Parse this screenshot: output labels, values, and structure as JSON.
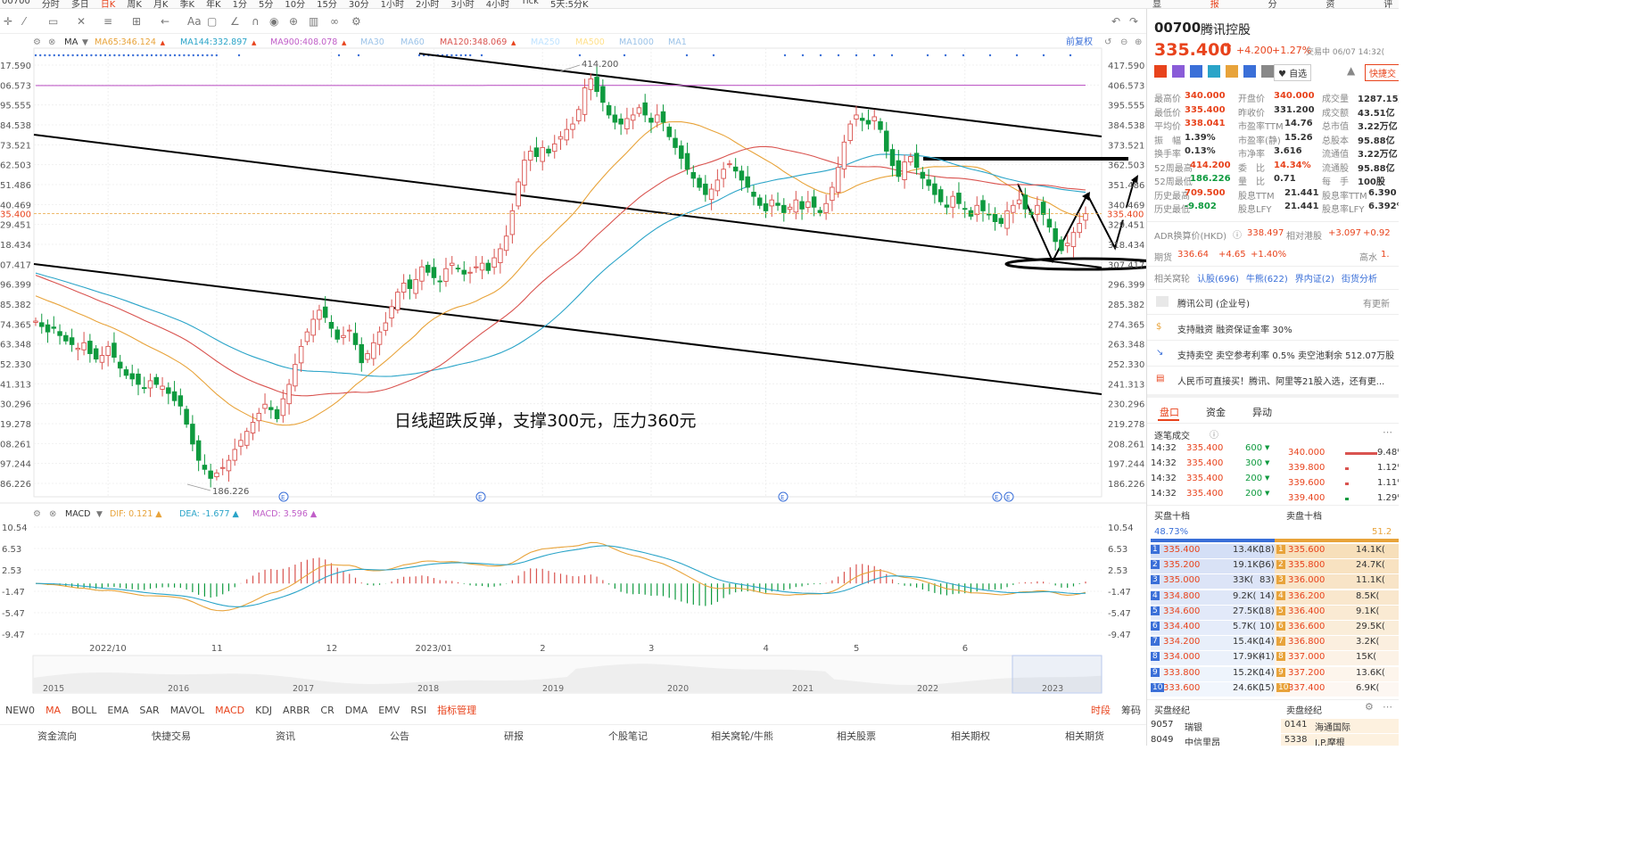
{
  "topbar": {
    "periods": [
      "00700",
      "分时",
      "多日",
      "日K",
      "周K",
      "月K",
      "季K",
      "年K",
      "1分",
      "5分",
      "10分",
      "15分",
      "30分",
      "1小时",
      "2小时",
      "3小时",
      "4小时",
      "Tick",
      "5天:5分K"
    ],
    "right": [
      "显示",
      "报价",
      "分析",
      "资讯",
      "评估"
    ]
  },
  "toolbar": {
    "restore": "前复权",
    "ma_label": "MA",
    "ma": [
      {
        "name": "MA65",
        "value": "346.124",
        "color": "#e8a33a"
      },
      {
        "name": "MA144",
        "value": "332.897",
        "color": "#2aa4c8"
      },
      {
        "name": "MA900",
        "value": "408.078",
        "color": "#c05ec8"
      },
      {
        "name": "MA30",
        "value": "",
        "color": "#9cc3e8"
      },
      {
        "name": "MA60",
        "value": "",
        "color": "#9cc3e8"
      },
      {
        "name": "MA120",
        "value": "348.069",
        "color": "#d9534f"
      },
      {
        "name": "MA250",
        "value": "",
        "color": "#bfe3ff"
      },
      {
        "name": "MA500",
        "value": "",
        "color": "#ffe08a"
      },
      {
        "name": "MA1000",
        "value": "",
        "color": "#9cc3e8"
      },
      {
        "name": "MA1",
        "value": "",
        "color": "#9cc3e8"
      }
    ]
  },
  "chart_data": [
    {
      "type": "candlestick",
      "title": "",
      "ylim": [
        180,
        420
      ],
      "y_ticks": [
        417.59,
        406.573,
        395.555,
        384.538,
        373.521,
        362.503,
        351.486,
        340.469,
        329.451,
        318.434,
        307.417,
        296.399,
        285.382,
        274.365,
        263.348,
        252.33,
        241.313,
        230.296,
        219.278,
        208.261,
        197.244,
        186.226
      ],
      "y_tick_labels": [
        "417.590",
        "406.573",
        "395.555",
        "384.538",
        "373.521",
        "362.503",
        "351.486",
        "340.469",
        "329.451",
        "318.434",
        "307.417",
        "296.399",
        "285.382",
        "274.365",
        "263.348",
        "252.330",
        "241.313",
        "230.296",
        "219.278",
        "208.261",
        "197.244",
        "186.226"
      ],
      "left_tick_labels": [
        "17.590",
        "06.573",
        "95.555",
        "84.538",
        "73.521",
        "62.503",
        "51.486",
        "40.469",
        "29.451",
        "18.434",
        "07.417",
        "96.399",
        "85.382",
        "74.365",
        "63.348",
        "52.330",
        "41.313",
        "30.296",
        "19.278",
        "08.261",
        "97.244",
        "86.226"
      ],
      "x_labels": [
        "2022/10",
        "11",
        "12",
        "2023/01",
        "2",
        "3",
        "4",
        "5",
        "6"
      ],
      "x_label_index": [
        12,
        30,
        49,
        66,
        84,
        102,
        121,
        136,
        154
      ],
      "current_price": 335.4,
      "current_price_label": "335.400",
      "left_price_label": "35.400",
      "high_mark": "414.200",
      "low_mark": "186.226",
      "annotation": "日线超跌反弹，支撑300元，压力360元",
      "closes": [
        276.0,
        273.0,
        270.0,
        272.0,
        268.0,
        265.0,
        263.0,
        261.0,
        264.0,
        258.0,
        255.0,
        257.0,
        262.0,
        256.0,
        250.0,
        246.0,
        244.0,
        241.0,
        239.0,
        243.0,
        241.0,
        240.0,
        236.0,
        232.0,
        229.0,
        219.0,
        208.0,
        199.0,
        194.0,
        189.0,
        192.0,
        195.0,
        199.0,
        205.0,
        210.0,
        215.0,
        220.0,
        225.0,
        230.0,
        227.0,
        222.0,
        233.0,
        241.0,
        252.0,
        262.0,
        270.0,
        277.0,
        282.0,
        278.0,
        272.0,
        266.0,
        268.0,
        271.0,
        263.0,
        253.0,
        258.0,
        264.0,
        270.0,
        275.0,
        284.0,
        292.0,
        297.0,
        294.0,
        299.0,
        306.0,
        303.0,
        300.0,
        298.0,
        305.0,
        308.0,
        305.0,
        302.0,
        303.0,
        306.0,
        308.0,
        304.0,
        311.0,
        316.0,
        323.0,
        337.0,
        353.0,
        365.0,
        370.0,
        367.0,
        372.0,
        369.0,
        374.0,
        378.0,
        382.0,
        385.0,
        393.0,
        405.0,
        410.0,
        403.0,
        397.0,
        390.0,
        386.0,
        385.0,
        388.0,
        390.0,
        394.0,
        390.0,
        386.0,
        390.0,
        386.0,
        378.0,
        372.0,
        366.0,
        360.0,
        355.0,
        350.0,
        346.0,
        349.0,
        354.0,
        360.0,
        363.0,
        359.0,
        354.0,
        350.0,
        345.0,
        340.0,
        337.0,
        343.0,
        340.0,
        336.0,
        339.0,
        343.0,
        338.0,
        342.0,
        339.0,
        336.0,
        341.0,
        350.0,
        361.0,
        375.0,
        385.0,
        390.0,
        387.0,
        385.0,
        389.0,
        382.0,
        370.0,
        362.0,
        356.0,
        364.0,
        367.0,
        361.0,
        355.0,
        351.0,
        346.0,
        342.0,
        339.0,
        345.0,
        341.0,
        338.0,
        334.0,
        340.0,
        337.0,
        335.0,
        331.0,
        330.0,
        337.0,
        340.0,
        343.0,
        338.0,
        335.0,
        340.0,
        335.0,
        328.0,
        320.0,
        315.0,
        319.0,
        325.0,
        330.0,
        335.4
      ],
      "series": [
        {
          "name": "MA65",
          "color": "#e8a33a"
        },
        {
          "name": "MA144",
          "color": "#2aa4c8"
        },
        {
          "name": "MA900",
          "color": "#c05ec8"
        },
        {
          "name": "MA120",
          "color": "#d9534f"
        }
      ]
    },
    {
      "type": "macd",
      "labels": {
        "name": "MACD",
        "dif": "0.121",
        "dea": "-1.677",
        "macd": "3.596"
      },
      "ylim": [
        -9.47,
        10.54
      ],
      "y_ticks": [
        10.54,
        6.53,
        2.53,
        -1.47,
        -5.47,
        -9.47
      ],
      "y_tick_labels": [
        "10.54",
        "6.53",
        "2.53",
        "-1.47",
        "-5.47",
        "-9.47"
      ],
      "colors": {
        "dif": "#e8a33a",
        "dea": "#2aa4c8",
        "up": "#d9534f",
        "down": "#0e9a3e"
      }
    },
    {
      "type": "area",
      "title": "overview",
      "x_labels": [
        "2015",
        "2016",
        "2017",
        "2018",
        "2019",
        "2020",
        "2021",
        "2022",
        "2023"
      ]
    }
  ],
  "indicator_tabs": [
    "NEW0",
    "MA",
    "BOLL",
    "EMA",
    "SAR",
    "MAVOL",
    "MACD",
    "KDJ",
    "ARBR",
    "CR",
    "DMA",
    "EMV",
    "RSI",
    "指标管理"
  ],
  "indicator_right": [
    "时段",
    "筹码"
  ],
  "bottom_nav": [
    "资金流向",
    "快捷交易",
    "资讯",
    "公告",
    "研报",
    "个股笔记",
    "相关窝轮/牛熊",
    "相关股票",
    "相关期权",
    "相关期货"
  ],
  "quote": {
    "code": "00700",
    "name": "腾讯控股",
    "price": "335.400",
    "arrow": "↑",
    "change": "+4.200",
    "pct": "+1.27%",
    "trade_status": "交易中 06/07 14:32(",
    "actions": [
      "自选",
      "快捷交"
    ],
    "stats": [
      [
        "最高价",
        "340.000",
        "开盘价",
        "340.000",
        "成交量",
        "1287.15万"
      ],
      [
        "最低价",
        "335.400",
        "昨收价",
        "331.200",
        "成交额",
        "43.51亿"
      ],
      [
        "平均价",
        "338.041",
        "市盈率TTM",
        "14.76",
        "总市值",
        "3.22万亿"
      ],
      [
        "振　幅",
        "1.39%",
        "市盈率(静)",
        "15.26",
        "总股本",
        "95.88亿"
      ],
      [
        "换手率",
        "0.13%",
        "市净率",
        "3.616",
        "流通值",
        "3.22万亿"
      ],
      [
        "52周最高",
        "414.200",
        "委　比",
        "14.34%",
        "流通股",
        "95.88亿"
      ],
      [
        "52周最低",
        "186.226",
        "量　比",
        "0.71",
        "每　手",
        "100股"
      ],
      [
        "历史最高",
        "709.500",
        "股息TTM",
        "21.441",
        "股息率TTM",
        "6.390"
      ],
      [
        "历史最低",
        "-9.802",
        "股息LFY",
        "21.441",
        "股息率LFY",
        "6.392%"
      ]
    ],
    "adr": {
      "label": "ADR换算价(HKD)",
      "value": "338.497",
      "rel_label": "相对港股",
      "rel_value": "+3.097",
      "rel_pct": "+0.92"
    },
    "futures": {
      "label": "期货",
      "value": "336.64",
      "change": "+4.65",
      "pct": "+1.40%",
      "right": "高水",
      "right_value": "1."
    },
    "related_links": [
      "相关窝轮",
      "认股(696)",
      "牛熊(622)",
      "界内证(2)",
      "街货分析"
    ],
    "company": {
      "name": "腾讯公司 (企业号)",
      "update": "有更新"
    },
    "notices": [
      "支持融资 融资保证金率 30%",
      "支持卖空 卖空参考利率 0.5% 卖空池剩余 512.07万股",
      "人民币可直接买！腾讯、阿里等21股入选，还有更..."
    ],
    "tabs": [
      "盘口",
      "资金",
      "异动"
    ],
    "ticks_title": "逐笔成交",
    "ticks": [
      [
        "14:32",
        "335.400",
        "600"
      ],
      [
        "14:32",
        "335.400",
        "300"
      ],
      [
        "14:32",
        "335.400",
        "200"
      ],
      [
        "14:32",
        "335.400",
        "200"
      ]
    ],
    "ask_levels": [
      [
        "340.000",
        "9.48%"
      ],
      [
        "339.800",
        "1.12%"
      ],
      [
        "339.600",
        "1.11%"
      ],
      [
        "339.400",
        "1.29%"
      ]
    ],
    "bid_title": "买盘十档",
    "ask_title": "卖盘十档",
    "bid_ratio": "48.73%",
    "ask_ratio": "51.2",
    "book": [
      [
        "1",
        "335.400",
        "13.4K(",
        "18)",
        "1",
        "335.600",
        "14.1K("
      ],
      [
        "2",
        "335.200",
        "19.1K(",
        "36)",
        "2",
        "335.800",
        "24.7K("
      ],
      [
        "3",
        "335.000",
        "33K(",
        "83)",
        "3",
        "336.000",
        "11.1K("
      ],
      [
        "4",
        "334.800",
        "9.2K(",
        "14)",
        "4",
        "336.200",
        "8.5K("
      ],
      [
        "5",
        "334.600",
        "27.5K(",
        "18)",
        "5",
        "336.400",
        "9.1K("
      ],
      [
        "6",
        "334.400",
        "5.7K(",
        "10)",
        "6",
        "336.600",
        "29.5K("
      ],
      [
        "7",
        "334.200",
        "15.4K(",
        "14)",
        "7",
        "336.800",
        "3.2K("
      ],
      [
        "8",
        "334.000",
        "17.9K(",
        "41)",
        "8",
        "337.000",
        "15K("
      ],
      [
        "9",
        "333.800",
        "15.2K(",
        "14)",
        "9",
        "337.200",
        "13.6K("
      ],
      [
        "10",
        "333.600",
        "24.6K(",
        "15)",
        "10",
        "337.400",
        "6.9K("
      ]
    ],
    "brokers_title_buy": "买盘经纪",
    "brokers_title_sell": "卖盘经纪",
    "brokers_buy": [
      [
        "9057",
        "瑞银"
      ],
      [
        "8049",
        "中信里昂"
      ]
    ],
    "brokers_sell": [
      [
        "0141",
        "海通国际"
      ],
      [
        "5338",
        "J.P.摩根"
      ]
    ]
  }
}
